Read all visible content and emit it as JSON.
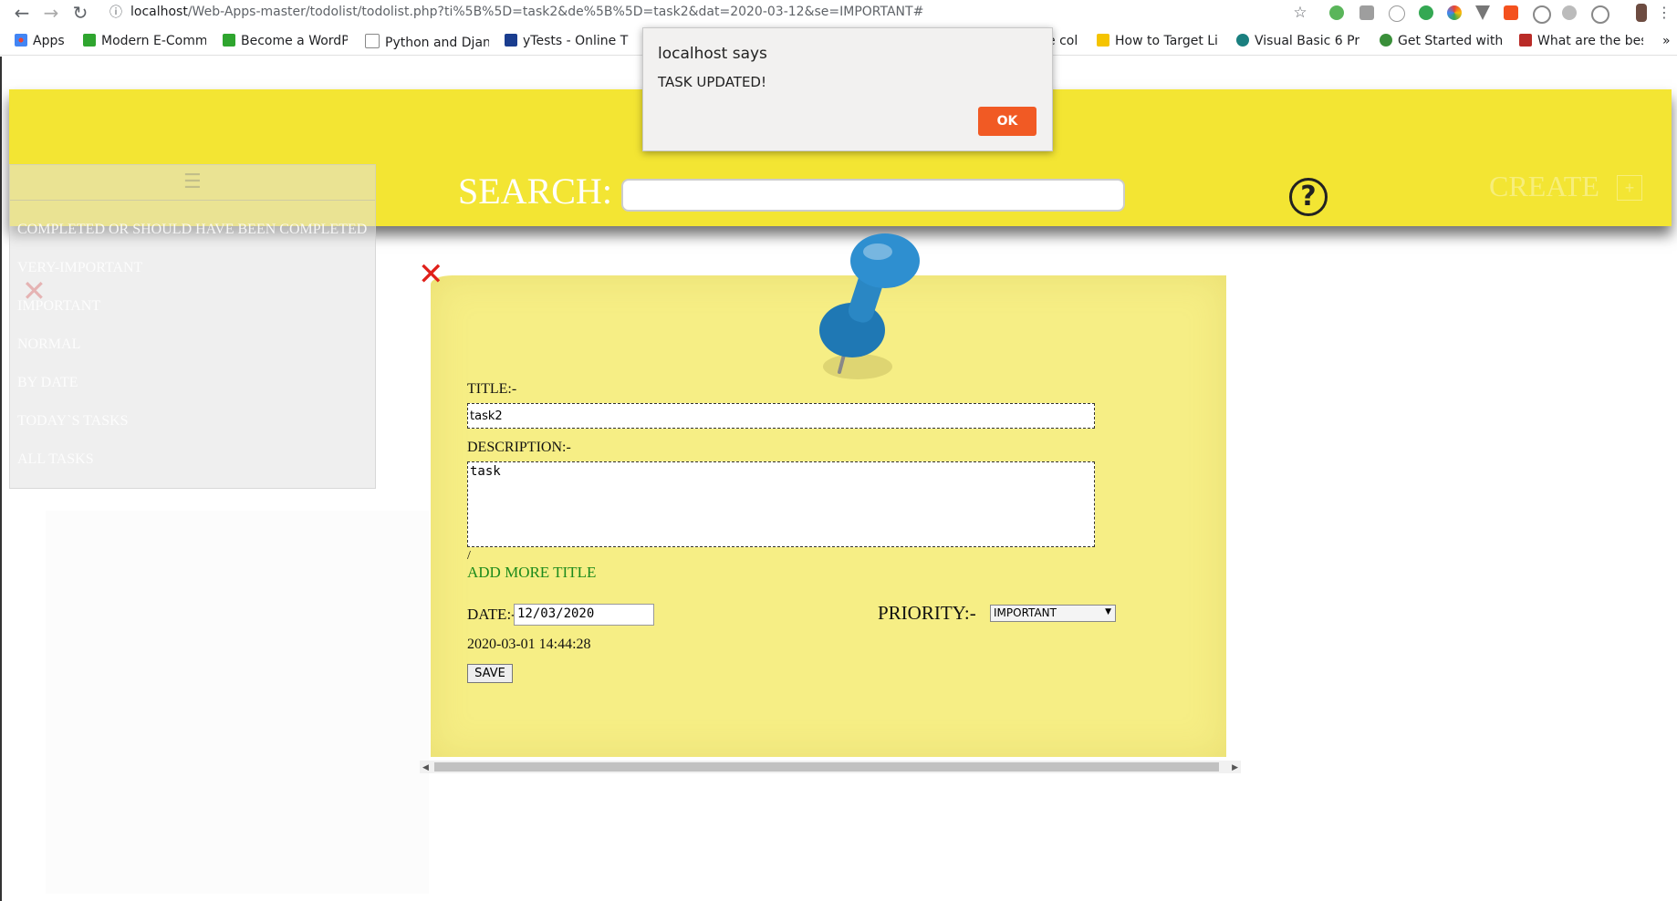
{
  "browser": {
    "url_host": "localhost",
    "url_path": "/Web-Apps-master/todolist/todolist.php?ti%5B%5D=task2&de%5B%5D=task2&dat=2020-03-12&se=IMPORTANT#",
    "back_icon": "arrow-left-icon",
    "forward_icon": "arrow-right-icon",
    "reload_icon": "reload-icon",
    "info_icon": "info-icon",
    "star_icon": "star-icon",
    "bookmarks": [
      {
        "label": "Apps",
        "icon": "apps-grid-icon",
        "color": "#4285f4"
      },
      {
        "label": "Modern E-Comm",
        "icon": "ftu-icon",
        "color": "#2fa52f"
      },
      {
        "label": "Become a WordP",
        "icon": "ftu-icon",
        "color": "#2fa52f"
      },
      {
        "label": "Python and Djan",
        "icon": "page-icon",
        "color": "#888888"
      },
      {
        "label": "yTests - Online T",
        "icon": "y-icon",
        "color": "#1a3d8f"
      },
      {
        "label": "e col",
        "icon": "",
        "color": ""
      },
      {
        "label": "How to Target Li",
        "icon": "l-icon",
        "color": "#f5c400"
      },
      {
        "label": "Visual Basic 6 Pr",
        "icon": "globe-icon",
        "color": "#1a7f7f"
      },
      {
        "label": "Get Started with",
        "icon": "dots-icon",
        "color": "#3a8f3a"
      },
      {
        "label": "What are the bes",
        "icon": "q-icon",
        "color": "#b92b27"
      }
    ],
    "more_bookmarks": "»"
  },
  "header": {
    "search_label": "SEARCH:",
    "search_value": "",
    "help_icon": "?",
    "create_label": "CREATE",
    "create_plus": "+"
  },
  "sidebar": {
    "menu_icon": "☰",
    "items": [
      "COMPLETED OR SHOULD HAVE BEEN COMPLETED",
      "VERY-IMPORTANT",
      "IMPORTANT",
      "NORMAL",
      "BY DATE",
      "TODAY`S TASKS",
      "ALL TASKS"
    ],
    "close_icon": "✕"
  },
  "note": {
    "close_icon": "✕",
    "title_label": "TITLE:-",
    "title_value": "task2",
    "description_label": "DESCRIPTION:-",
    "description_value": "task",
    "slash": "/",
    "add_more_title": "ADD MORE TITLE",
    "date_label": "DATE:-",
    "date_value": "12/03/2020",
    "priority_label": "PRIORITY:-",
    "priority_value": "IMPORTANT",
    "timestamp": "2020-03-01 14:44:28",
    "save_label": "SAVE"
  },
  "alert": {
    "title": "localhost says",
    "message": "TASK UPDATED!",
    "ok_label": "OK"
  },
  "colors": {
    "header_yellow": "#f3e533",
    "note_yellow": "#f6ee85",
    "ok_orange": "#f15a24",
    "close_red": "#e0201a",
    "link_green": "#1c8a1c",
    "pin_blue": "#1f78b4"
  }
}
